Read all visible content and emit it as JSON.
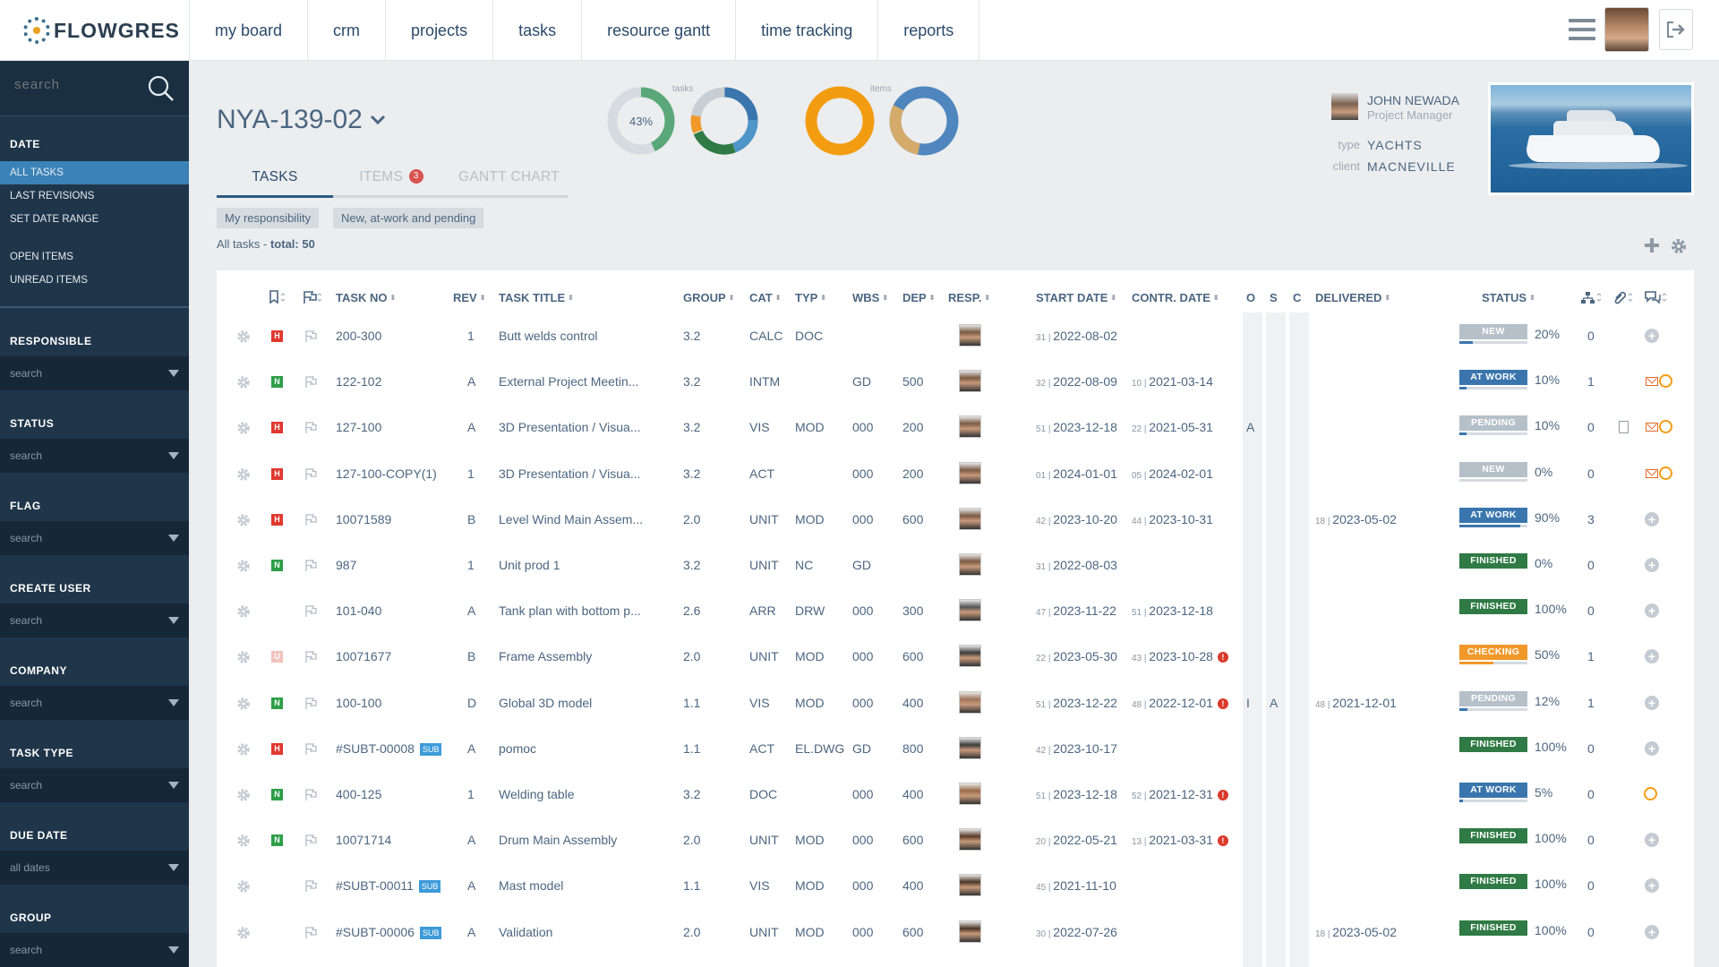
{
  "app": {
    "logo_text": "FLOWGRES"
  },
  "nav": [
    "my board",
    "crm",
    "projects",
    "tasks",
    "resource gantt",
    "time tracking",
    "reports"
  ],
  "sidebar": {
    "search_placeholder": "search",
    "date_label": "DATE",
    "date_links": [
      "ALL TASKS",
      "LAST REVISIONS",
      "SET DATE RANGE"
    ],
    "item_links": [
      "OPEN ITEMS",
      "UNREAD ITEMS"
    ],
    "filters": [
      {
        "label": "RESPONSIBLE",
        "value": "search"
      },
      {
        "label": "STATUS",
        "value": "search"
      },
      {
        "label": "FLAG",
        "value": "search"
      },
      {
        "label": "CREATE USER",
        "value": "search"
      },
      {
        "label": "COMPANY",
        "value": "search"
      },
      {
        "label": "TASK TYPE",
        "value": "search"
      },
      {
        "label": "DUE DATE",
        "value": "all dates"
      },
      {
        "label": "GROUP",
        "value": "search"
      }
    ]
  },
  "project": {
    "title": "NYA-139-02",
    "manager_name": "JOHN NEWADA",
    "manager_role": "Project Manager",
    "type_key": "type",
    "type_value": "YACHTS",
    "client_key": "client",
    "client_value": "MACNEVILLE"
  },
  "donuts": {
    "tasks_label": "tasks",
    "items_label": "items",
    "tasks_percent": "43%"
  },
  "tabs": [
    {
      "label": "TASKS",
      "active": true
    },
    {
      "label": "ITEMS",
      "badge": "3"
    },
    {
      "label": "GANTT CHART"
    }
  ],
  "chips": [
    "My responsibility",
    "New, at-work and pending"
  ],
  "total": {
    "label": "All tasks - ",
    "value": "total: 50"
  },
  "columns": {
    "task_no": "TASK NO",
    "rev": "REV",
    "title": "TASK TITLE",
    "group": "GROUP",
    "cat": "CAT",
    "typ": "TYP",
    "wbs": "WBS",
    "dep": "DEP",
    "resp": "RESP.",
    "start": "START DATE",
    "contr": "CONTR. DATE",
    "o": "O",
    "s": "S",
    "c": "C",
    "delivered": "DELIVERED",
    "status": "STATUS"
  },
  "colors": {
    "new": "#b6c0c9",
    "atwork": "#3a76ad",
    "pending": "#b6c0c9",
    "finished": "#2f7a45",
    "checking": "#f0982a"
  },
  "rows": [
    {
      "prio": "H",
      "no": "200-300",
      "sub": false,
      "rev": "1",
      "title": "Butt welds control",
      "group": "3.2",
      "cat": "CALC",
      "typ": "DOC",
      "wbs": "",
      "dep": "",
      "start_wk": "31",
      "start": "2022-08-02",
      "contr_wk": "",
      "contr": "",
      "contr_warn": false,
      "o": "",
      "s": "",
      "deliv_wk": "",
      "deliv": "",
      "status": "NEW",
      "status_color": "#b6c0c9",
      "progress": 0.2,
      "pct": "20%",
      "sub_count": "0",
      "mail": false,
      "ring": false,
      "doc": false
    },
    {
      "prio": "N",
      "no": "122-102",
      "sub": false,
      "rev": "A",
      "title": "External Project Meetin...",
      "group": "3.2",
      "cat": "INTM",
      "typ": "",
      "wbs": "GD",
      "dep": "500",
      "start_wk": "32",
      "start": "2022-08-09",
      "contr_wk": "10",
      "contr": "2021-03-14",
      "contr_warn": false,
      "o": "",
      "s": "",
      "deliv_wk": "",
      "deliv": "",
      "status": "AT WORK",
      "status_color": "#3a76ad",
      "progress": 0.1,
      "pct": "10%",
      "sub_count": "1",
      "mail": true,
      "ring": true,
      "doc": false
    },
    {
      "prio": "H",
      "no": "127-100",
      "sub": false,
      "rev": "A",
      "title": "3D Presentation / Visua...",
      "group": "3.2",
      "cat": "VIS",
      "typ": "MOD",
      "wbs": "000",
      "dep": "200",
      "start_wk": "51",
      "start": "2023-12-18",
      "contr_wk": "22",
      "contr": "2021-05-31",
      "contr_warn": false,
      "o": "A",
      "s": "",
      "deliv_wk": "",
      "deliv": "",
      "status": "PENDING",
      "status_color": "#b6c0c9",
      "progress": 0.1,
      "pct": "10%",
      "sub_count": "0",
      "mail": true,
      "ring": true,
      "doc": true
    },
    {
      "prio": "H",
      "no": "127-100-COPY(1)",
      "sub": false,
      "rev": "1",
      "title": "3D Presentation / Visua...",
      "group": "3.2",
      "cat": "ACT",
      "typ": "",
      "wbs": "000",
      "dep": "200",
      "start_wk": "01",
      "start": "2024-01-01",
      "contr_wk": "05",
      "contr": "2024-02-01",
      "contr_warn": false,
      "o": "",
      "s": "",
      "deliv_wk": "",
      "deliv": "",
      "status": "NEW",
      "status_color": "#b6c0c9",
      "progress": 0.0,
      "pct": "0%",
      "sub_count": "0",
      "mail": true,
      "ring": true,
      "doc": false
    },
    {
      "prio": "H",
      "no": "10071589",
      "sub": false,
      "rev": "B",
      "title": "Level Wind Main Assem...",
      "group": "2.0",
      "cat": "UNIT",
      "typ": "MOD",
      "wbs": "000",
      "dep": "600",
      "start_wk": "42",
      "start": "2023-10-20",
      "contr_wk": "44",
      "contr": "2023-10-31",
      "contr_warn": false,
      "o": "",
      "s": "",
      "deliv_wk": "18",
      "deliv": "2023-05-02",
      "status": "AT WORK",
      "status_color": "#3a76ad",
      "progress": 0.9,
      "pct": "90%",
      "sub_count": "3",
      "mail": false,
      "ring": false,
      "doc": false
    },
    {
      "prio": "N",
      "no": "987",
      "sub": false,
      "rev": "1",
      "title": "Unit prod 1",
      "group": "3.2",
      "cat": "UNIT",
      "typ": "NC",
      "wbs": "GD",
      "dep": "",
      "start_wk": "31",
      "start": "2022-08-03",
      "contr_wk": "",
      "contr": "",
      "contr_warn": false,
      "o": "",
      "s": "",
      "deliv_wk": "",
      "deliv": "",
      "status": "FINISHED",
      "status_color": "#2f7a45",
      "progress": null,
      "pct": "0%",
      "sub_count": "0",
      "mail": false,
      "ring": false,
      "doc": false
    },
    {
      "prio": "",
      "no": "101-040",
      "sub": false,
      "rev": "A",
      "title": "Tank plan with bottom p...",
      "group": "2.6",
      "cat": "ARR",
      "typ": "DRW",
      "wbs": "000",
      "dep": "300",
      "start_wk": "47",
      "start": "2023-11-22",
      "contr_wk": "51",
      "contr": "2023-12-18",
      "contr_warn": false,
      "o": "",
      "s": "",
      "deliv_wk": "",
      "deliv": "",
      "status": "FINISHED",
      "status_color": "#2f7a45",
      "progress": null,
      "pct": "100%",
      "sub_count": "0",
      "mail": false,
      "ring": false,
      "doc": false
    },
    {
      "prio": "U",
      "no": "10071677",
      "sub": false,
      "rev": "B",
      "title": "Frame Assembly",
      "group": "2.0",
      "cat": "UNIT",
      "typ": "MOD",
      "wbs": "000",
      "dep": "600",
      "start_wk": "22",
      "start": "2023-05-30",
      "contr_wk": "43",
      "contr": "2023-10-28",
      "contr_warn": true,
      "o": "",
      "s": "",
      "deliv_wk": "",
      "deliv": "",
      "status": "CHECKING",
      "status_color": "#f0982a",
      "progress": 0.5,
      "pct": "50%",
      "sub_count": "1",
      "mail": false,
      "ring": false,
      "doc": false
    },
    {
      "prio": "N",
      "no": "100-100",
      "sub": false,
      "rev": "D",
      "title": "Global 3D model",
      "group": "1.1",
      "cat": "VIS",
      "typ": "MOD",
      "wbs": "000",
      "dep": "400",
      "start_wk": "51",
      "start": "2023-12-22",
      "contr_wk": "48",
      "contr": "2022-12-01",
      "contr_warn": true,
      "o": "I",
      "s": "A",
      "deliv_wk": "48",
      "deliv": "2021-12-01",
      "status": "PENDING",
      "status_color": "#b6c0c9",
      "progress": 0.12,
      "pct": "12%",
      "sub_count": "1",
      "mail": false,
      "ring": false,
      "doc": false
    },
    {
      "prio": "H",
      "no": "#SUBT-00008",
      "sub": true,
      "rev": "A",
      "title": "pomoc",
      "group": "1.1",
      "cat": "ACT",
      "typ": "EL.DWG",
      "wbs": "GD",
      "dep": "800",
      "start_wk": "42",
      "start": "2023-10-17",
      "contr_wk": "",
      "contr": "",
      "contr_warn": false,
      "o": "",
      "s": "",
      "deliv_wk": "",
      "deliv": "",
      "status": "FINISHED",
      "status_color": "#2f7a45",
      "progress": null,
      "pct": "100%",
      "sub_count": "0",
      "mail": false,
      "ring": false,
      "doc": false
    },
    {
      "prio": "N",
      "no": "400-125",
      "sub": false,
      "rev": "1",
      "title": "Welding table",
      "group": "3.2",
      "cat": "DOC",
      "typ": "",
      "wbs": "000",
      "dep": "400",
      "start_wk": "51",
      "start": "2023-12-18",
      "contr_wk": "52",
      "contr": "2021-12-31",
      "contr_warn": true,
      "o": "",
      "s": "",
      "deliv_wk": "",
      "deliv": "",
      "status": "AT WORK",
      "status_color": "#3a76ad",
      "progress": 0.05,
      "pct": "5%",
      "sub_count": "0",
      "mail": false,
      "ring": true,
      "doc": false
    },
    {
      "prio": "N",
      "no": "10071714",
      "sub": false,
      "rev": "A",
      "title": "Drum Main Assembly",
      "group": "2.0",
      "cat": "UNIT",
      "typ": "MOD",
      "wbs": "000",
      "dep": "600",
      "start_wk": "20",
      "start": "2022-05-21",
      "contr_wk": "13",
      "contr": "2021-03-31",
      "contr_warn": true,
      "o": "",
      "s": "",
      "deliv_wk": "",
      "deliv": "",
      "status": "FINISHED",
      "status_color": "#2f7a45",
      "progress": null,
      "pct": "100%",
      "sub_count": "0",
      "mail": false,
      "ring": false,
      "doc": false
    },
    {
      "prio": "",
      "no": "#SUBT-00011",
      "sub": true,
      "rev": "A",
      "title": "Mast model",
      "group": "1.1",
      "cat": "VIS",
      "typ": "MOD",
      "wbs": "000",
      "dep": "400",
      "start_wk": "45",
      "start": "2021-11-10",
      "contr_wk": "",
      "contr": "",
      "contr_warn": false,
      "o": "",
      "s": "",
      "deliv_wk": "",
      "deliv": "",
      "status": "FINISHED",
      "status_color": "#2f7a45",
      "progress": null,
      "pct": "100%",
      "sub_count": "0",
      "mail": false,
      "ring": false,
      "doc": false
    },
    {
      "prio": "",
      "no": "#SUBT-00006",
      "sub": true,
      "rev": "A",
      "title": "Validation",
      "group": "2.0",
      "cat": "UNIT",
      "typ": "MOD",
      "wbs": "000",
      "dep": "600",
      "start_wk": "30",
      "start": "2022-07-26",
      "contr_wk": "",
      "contr": "",
      "contr_warn": false,
      "o": "",
      "s": "",
      "deliv_wk": "18",
      "deliv": "2023-05-02",
      "status": "FINISHED",
      "status_color": "#2f7a45",
      "progress": null,
      "pct": "100%",
      "sub_count": "0",
      "mail": false,
      "ring": false,
      "doc": false
    }
  ],
  "sub_label": "SUB"
}
